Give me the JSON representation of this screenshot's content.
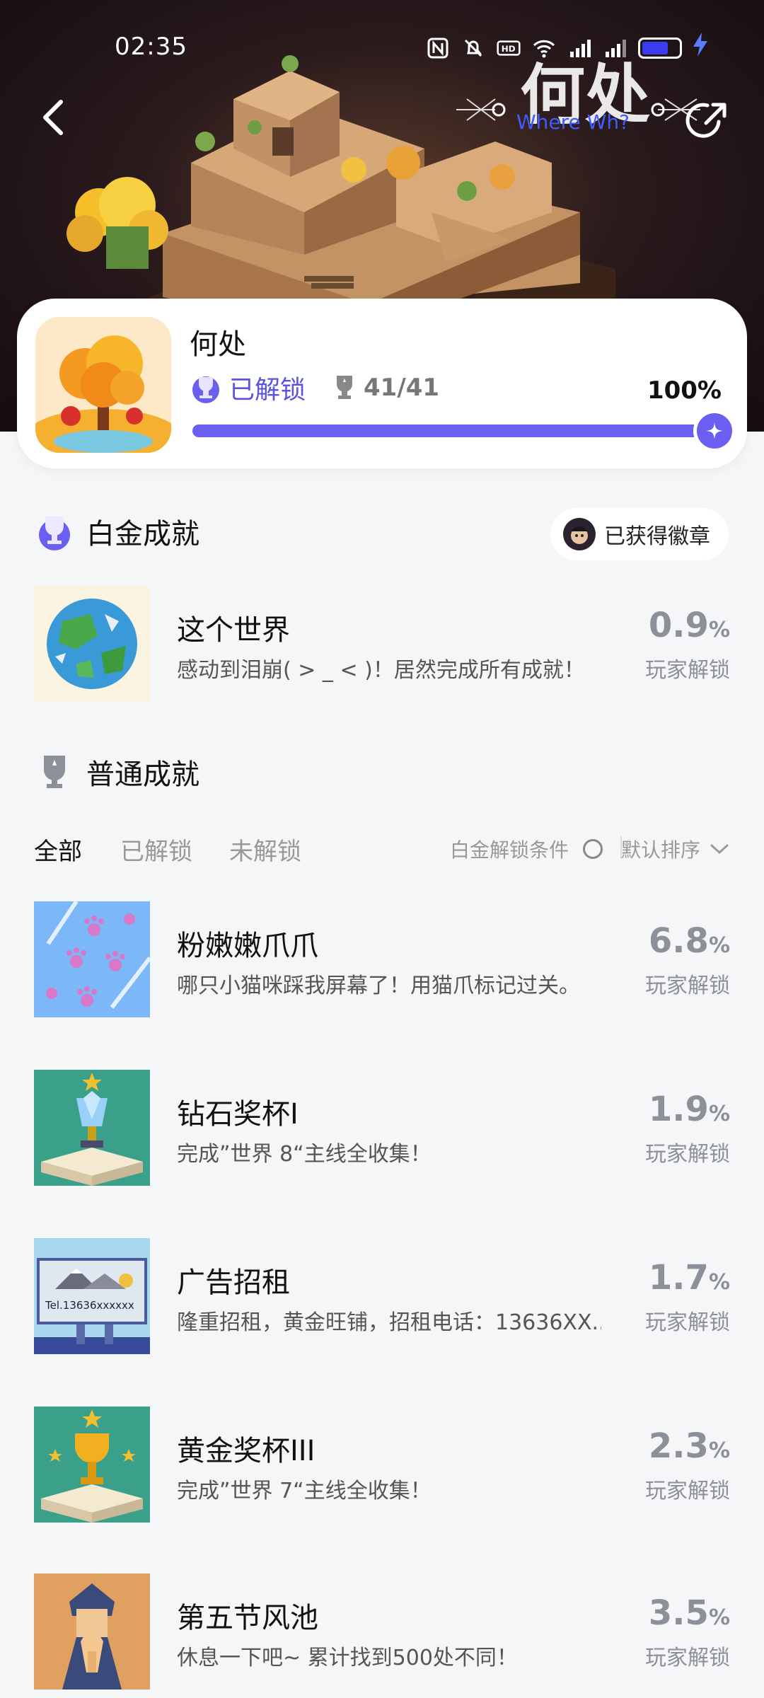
{
  "status_bar": {
    "time": "02:35",
    "icons": [
      "nfc-icon",
      "mute-icon",
      "hd-icon",
      "wifi-icon",
      "signal-5g-icon",
      "signal-5g-icon",
      "battery-icon",
      "charging-icon"
    ]
  },
  "header": {
    "logo_title": "何处",
    "logo_subtitle": "Where Wh?",
    "back_icon": "chevron-left-icon",
    "share_icon": "share-icon"
  },
  "game": {
    "name": "何处",
    "unlock_label": "已解锁",
    "trophy_count": "41/41",
    "percent_text": "100%",
    "progress": 1.0
  },
  "platinum": {
    "section_title": "白金成就",
    "badge_button": "已获得徽章",
    "achievement": {
      "title": "这个世界",
      "desc": "感动到泪崩( > _ < )！居然完成所有成就！",
      "pct": "0.9",
      "unit": "%",
      "label": "玩家解锁"
    }
  },
  "normal": {
    "section_title": "普通成就",
    "tabs": [
      "全部",
      "已解锁",
      "未解锁"
    ],
    "condition_label": "白金解锁条件",
    "sort_label": "默认排序",
    "achievements": [
      {
        "title": "粉嫩嫩爪爪",
        "desc": "哪只小猫咪踩我屏幕了！用猫爪标记过关。",
        "pct": "6.8",
        "unit": "%",
        "label": "玩家解锁"
      },
      {
        "title": "钻石奖杯I",
        "desc": "完成”世界 8“主线全收集！",
        "pct": "1.9",
        "unit": "%",
        "label": "玩家解锁"
      },
      {
        "title": "广告招租",
        "desc": "隆重招租，黄金旺铺，招租电话：13636XX...",
        "pct": "1.7",
        "unit": "%",
        "label": "玩家解锁"
      },
      {
        "title": "黄金奖杯III",
        "desc": "完成”世界 7“主线全收集！",
        "pct": "2.3",
        "unit": "%",
        "label": "玩家解锁"
      },
      {
        "title": "第五节风池",
        "desc": "休息一下吧~ 累计找到500处不同！",
        "pct": "3.5",
        "unit": "%",
        "label": "玩家解锁"
      }
    ],
    "billboard_text": "Tel.13636xxxxxx"
  },
  "colors": {
    "accent": "#6a5ff0",
    "unlock_text": "#5b53e0",
    "muted": "#8e9099",
    "background": "#f5f6f8"
  }
}
